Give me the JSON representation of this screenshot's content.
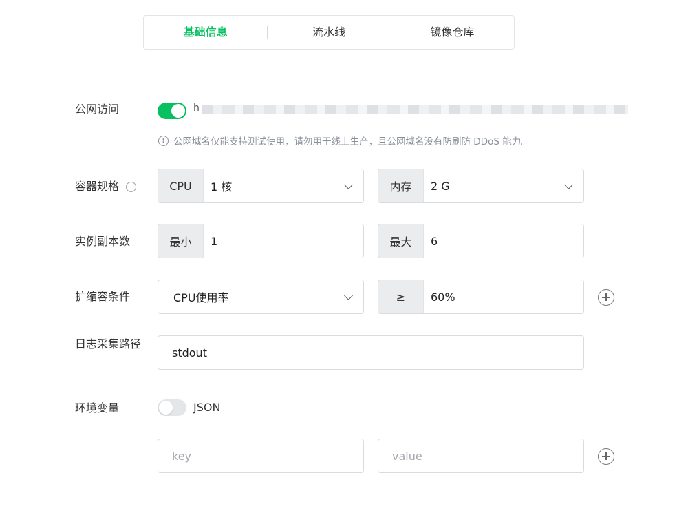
{
  "tabs": [
    {
      "label": "基础信息",
      "active": true
    },
    {
      "label": "流水线",
      "active": false
    },
    {
      "label": "镜像仓库",
      "active": false
    }
  ],
  "public_access": {
    "label": "公网访问",
    "enabled": true,
    "url_prefix": "h",
    "hint": "公网域名仅能支持测试使用，请勿用于线上生产，且公网域名没有防刷防 DDoS 能力。",
    "hint_icon": "info-icon"
  },
  "container_spec": {
    "label": "容器规格",
    "help_icon": "info-icon",
    "cpu_addon": "CPU",
    "cpu_value": "1 核",
    "mem_addon": "内存",
    "mem_value": "2 G"
  },
  "replicas": {
    "label": "实例副本数",
    "min_addon": "最小",
    "min_value": "1",
    "max_addon": "最大",
    "max_value": "6"
  },
  "scaling": {
    "label": "扩缩容条件",
    "metric_value": "CPU使用率",
    "op_addon": "≥",
    "threshold_value": "60%",
    "add_icon": "plus-circle-icon"
  },
  "log_path": {
    "label": "日志采集路径",
    "value": "stdout"
  },
  "env_vars": {
    "label": "环境变量",
    "json_enabled": false,
    "json_label": "JSON",
    "key_placeholder": "key",
    "value_placeholder": "value",
    "add_icon": "plus-circle-icon"
  },
  "colors": {
    "accent": "#07c160",
    "addon_bg": "#ebecee",
    "border": "#d9dbe0"
  }
}
